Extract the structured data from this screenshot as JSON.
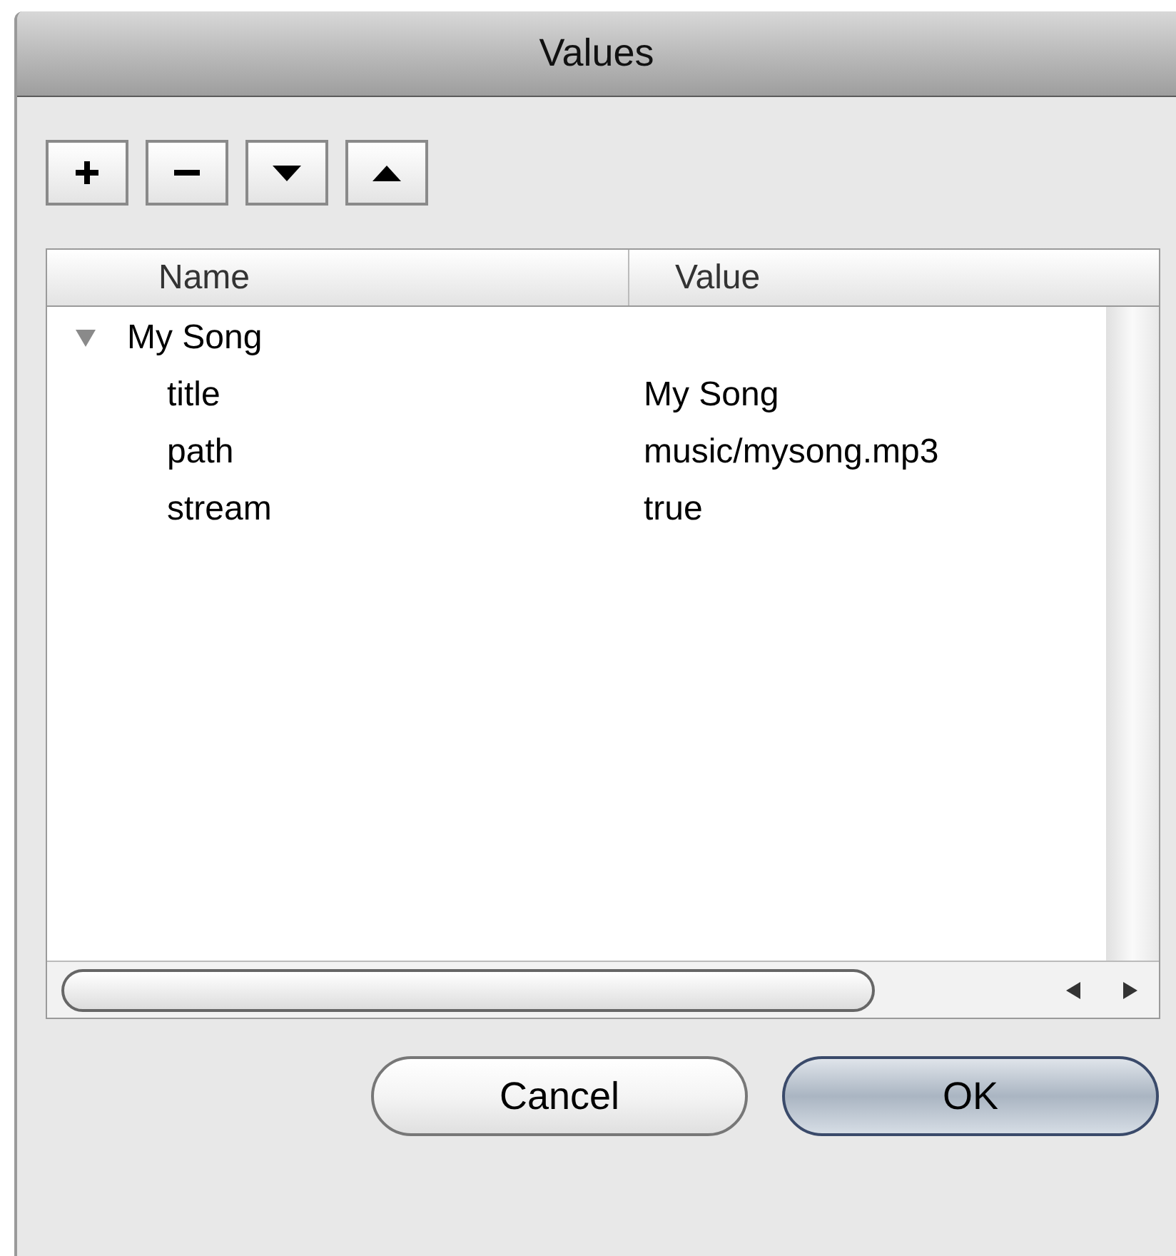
{
  "window": {
    "title": "Values"
  },
  "toolbar": [
    {
      "kind": "add"
    },
    {
      "kind": "remove"
    },
    {
      "kind": "down"
    },
    {
      "kind": "up"
    }
  ],
  "table": {
    "columns": [
      "Name",
      "Value"
    ],
    "rows": [
      {
        "name": "My Song",
        "expanded": true,
        "children": [
          {
            "name": "title",
            "value": "My Song"
          },
          {
            "name": "path",
            "value": "music/mysong.mp3"
          },
          {
            "name": "stream",
            "value": "true"
          }
        ]
      }
    ]
  },
  "buttons": [
    {
      "label": "Cancel",
      "default": false
    },
    {
      "label": "OK",
      "default": true
    }
  ]
}
